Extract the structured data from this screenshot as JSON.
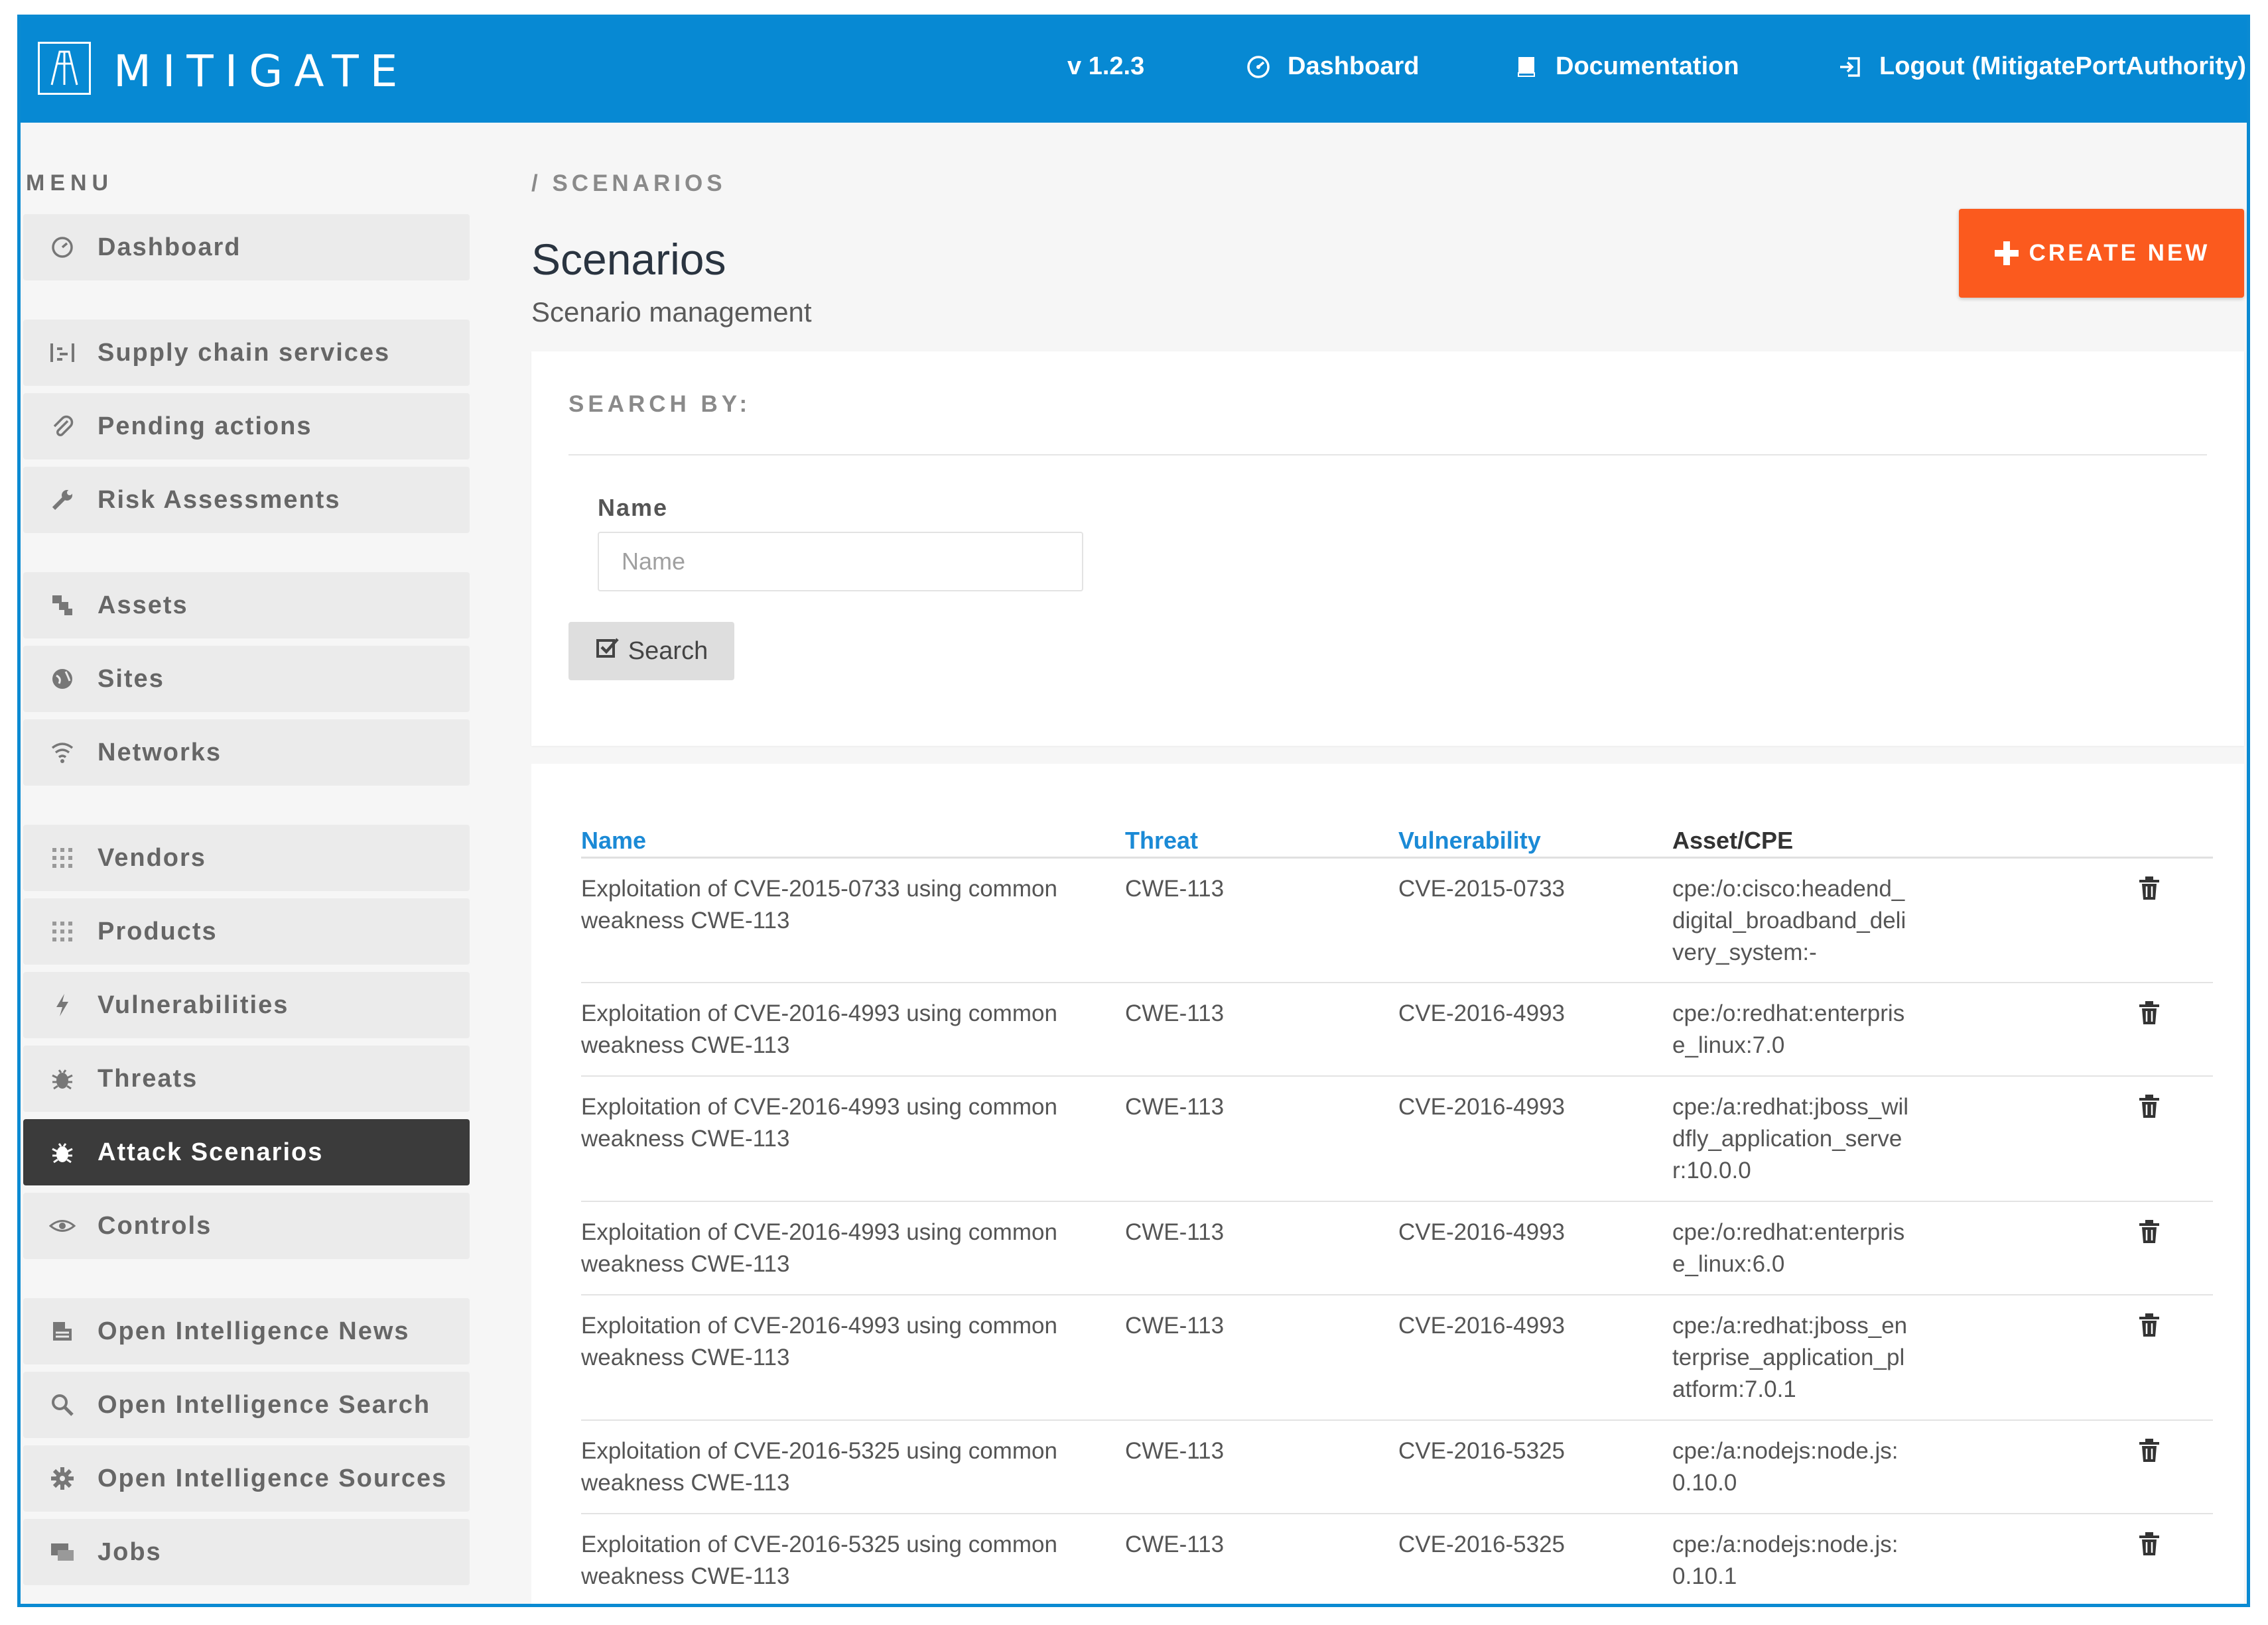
{
  "brand": {
    "name": "MITIGATE"
  },
  "header": {
    "version": "v 1.2.3",
    "nav": {
      "dashboard": "Dashboard",
      "documentation": "Documentation",
      "logout": "Logout (MitigatePortAuthority)"
    }
  },
  "sidebar": {
    "heading": "MENU",
    "items": [
      {
        "label": "Dashboard",
        "icon": "dashboard-icon",
        "active": false
      },
      {
        "label": "Supply chain services",
        "icon": "supply-chain-icon",
        "active": false
      },
      {
        "label": "Pending actions",
        "icon": "paperclip-icon",
        "active": false
      },
      {
        "label": "Risk Assessments",
        "icon": "wrench-icon",
        "active": false
      },
      {
        "label": "Assets",
        "icon": "assets-icon",
        "active": false
      },
      {
        "label": "Sites",
        "icon": "globe-icon",
        "active": false
      },
      {
        "label": "Networks",
        "icon": "wifi-icon",
        "active": false
      },
      {
        "label": "Vendors",
        "icon": "grid-icon",
        "active": false
      },
      {
        "label": "Products",
        "icon": "grid-icon",
        "active": false
      },
      {
        "label": "Vulnerabilities",
        "icon": "bolt-icon",
        "active": false
      },
      {
        "label": "Threats",
        "icon": "bug-icon",
        "active": false
      },
      {
        "label": "Attack Scenarios",
        "icon": "bug-icon",
        "active": true
      },
      {
        "label": "Controls",
        "icon": "eye-icon",
        "active": false
      },
      {
        "label": "Open Intelligence News",
        "icon": "newspaper-icon",
        "active": false
      },
      {
        "label": "Open Intelligence Search",
        "icon": "search-icon",
        "active": false
      },
      {
        "label": "Open Intelligence Sources",
        "icon": "gear-icon",
        "active": false
      },
      {
        "label": "Jobs",
        "icon": "jobs-icon",
        "active": false
      }
    ]
  },
  "main": {
    "breadcrumb": "/ SCENARIOS",
    "title": "Scenarios",
    "subtitle": "Scenario management",
    "create_label": "CREATE NEW",
    "search": {
      "heading": "SEARCH BY:",
      "name_label": "Name",
      "name_placeholder": "Name",
      "name_value": "",
      "button_label": "Search"
    },
    "table": {
      "headers": {
        "name": "Name",
        "threat": "Threat",
        "vulnerability": "Vulnerability",
        "asset": "Asset/CPE"
      },
      "rows": [
        {
          "name": "Exploitation of CVE-2015-0733 using common weakness CWE-113",
          "threat": "CWE-113",
          "vulnerability": "CVE-2015-0733",
          "asset": "cpe:/o:cisco:headend_digital_broadband_delivery_system:-"
        },
        {
          "name": "Exploitation of CVE-2016-4993 using common weakness CWE-113",
          "threat": "CWE-113",
          "vulnerability": "CVE-2016-4993",
          "asset": "cpe:/o:redhat:enterprise_linux:7.0"
        },
        {
          "name": "Exploitation of CVE-2016-4993 using common weakness CWE-113",
          "threat": "CWE-113",
          "vulnerability": "CVE-2016-4993",
          "asset": "cpe:/a:redhat:jboss_wildfly_application_server:10.0.0"
        },
        {
          "name": "Exploitation of CVE-2016-4993 using common weakness CWE-113",
          "threat": "CWE-113",
          "vulnerability": "CVE-2016-4993",
          "asset": "cpe:/o:redhat:enterprise_linux:6.0"
        },
        {
          "name": "Exploitation of CVE-2016-4993 using common weakness CWE-113",
          "threat": "CWE-113",
          "vulnerability": "CVE-2016-4993",
          "asset": "cpe:/a:redhat:jboss_enterprise_application_platform:7.0.1"
        },
        {
          "name": "Exploitation of CVE-2016-5325 using common weakness CWE-113",
          "threat": "CWE-113",
          "vulnerability": "CVE-2016-5325",
          "asset": "cpe:/a:nodejs:node.js:0.10.0"
        },
        {
          "name": "Exploitation of CVE-2016-5325 using common weakness CWE-113",
          "threat": "CWE-113",
          "vulnerability": "CVE-2016-5325",
          "asset": "cpe:/a:nodejs:node.js:0.10.1"
        }
      ]
    }
  },
  "colors": {
    "header": "#0789d3",
    "accent": "#fb5a1e",
    "link": "#1b8ad6",
    "active_item": "#3b3b3b"
  }
}
